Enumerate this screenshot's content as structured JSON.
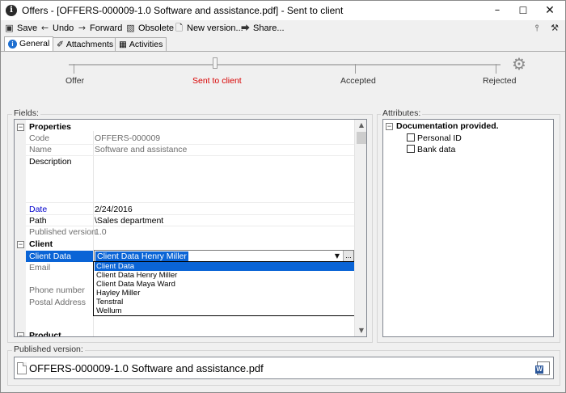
{
  "window": {
    "title": "Offers - [OFFERS-000009-1.0 Software and assistance.pdf] - Sent to client",
    "app_icon": "i",
    "controls": {
      "minimize": "–",
      "maximize": "☐",
      "close": "✕"
    }
  },
  "toolbar": {
    "save": "Save",
    "undo": "Undo",
    "forward": "Forward",
    "obsolete": "Obsolete",
    "new_version": "New version...",
    "share": "Share...",
    "icons": {
      "save": "floppy-icon",
      "undo": "arrow-left-icon",
      "forward": "arrow-right-icon",
      "obsolete": "obsolete-icon",
      "new_version": "document-icon",
      "share": "share-icon",
      "pin": "pin-icon",
      "wrench": "wrench-icon"
    }
  },
  "tabs": [
    {
      "label": "General",
      "active": true
    },
    {
      "label": "Attachments",
      "active": false
    },
    {
      "label": "Activities",
      "active": false
    }
  ],
  "workflow": {
    "stages": [
      "Offer",
      "Sent to client",
      "Accepted",
      "Rejected"
    ],
    "current_stage": "Sent to client",
    "current_color": "#d80000"
  },
  "fields": {
    "group_title": "Fields:",
    "properties": {
      "title": "Properties",
      "code_label": "Code",
      "code_value": "OFFERS-000009",
      "name_label": "Name",
      "name_value": "Software and assistance",
      "description_label": "Description",
      "date_label": "Date",
      "date_value": "2/24/2016",
      "path_label": "Path",
      "path_value": "\\Sales department",
      "published_version_label": "Published version",
      "published_version_value": "1.0"
    },
    "client": {
      "title": "Client",
      "client_data_label": "Client Data",
      "client_data_value": "Client Data Henry Miller",
      "email_label": "Email",
      "phone_label": "Phone number",
      "postal_label": "Postal Address"
    },
    "product": {
      "title": "Product"
    },
    "dropdown": {
      "options": [
        "Client Data",
        "Client Data Henry Miller",
        "Client Data Maya Ward",
        "Hayley Miller",
        "Tenstral",
        "Wellum"
      ],
      "highlighted": "Client Data"
    }
  },
  "attributes": {
    "group_title": "Attributes:",
    "category": "Documentation provided.",
    "items": [
      {
        "label": "Personal ID",
        "checked": false
      },
      {
        "label": "Bank data",
        "checked": false
      }
    ]
  },
  "published": {
    "group_title": "Published version:",
    "file_name": "OFFERS-000009-1.0 Software and assistance.pdf",
    "word_icon_letter": "W"
  },
  "colors": {
    "selection": "#0a64d6",
    "accent_red": "#d80000",
    "date_label": "#0000cc"
  }
}
